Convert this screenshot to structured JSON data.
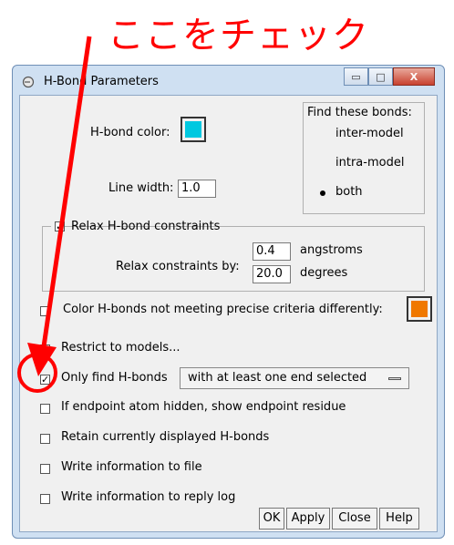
{
  "annotation": {
    "text": "ここをチェック",
    "color": "#ff0000"
  },
  "window": {
    "title": "H-Bond Parameters",
    "controls": {
      "minimize": "▭",
      "maximize": "□",
      "close": "X"
    }
  },
  "hbond_color": {
    "label": "H-bond color:",
    "color": "#00c8e0"
  },
  "line_width": {
    "label": "Line width:",
    "value": "1.0"
  },
  "find_bonds": {
    "title": "Find these bonds:",
    "options": [
      "inter-model",
      "intra-model",
      "both"
    ],
    "selected": "both"
  },
  "relax": {
    "checkbox_label": "Relax H-bond constraints",
    "checked": true,
    "by_label": "Relax constraints by:",
    "angstroms_value": "0.4",
    "angstroms_unit": "angstroms",
    "degrees_value": "20.0",
    "degrees_unit": "degrees"
  },
  "color_criteria": {
    "label": "Color H-bonds not meeting precise criteria differently:",
    "checked": false,
    "color": "#f07800"
  },
  "options": {
    "restrict_models": {
      "label": "Restrict to models...",
      "checked": false
    },
    "only_find": {
      "label": "Only find H-bonds",
      "checked": true,
      "dropdown_value": "with at least one end selected"
    },
    "endpoint_hidden": {
      "label": "If endpoint atom hidden, show endpoint residue",
      "checked": false
    },
    "retain_displayed": {
      "label": "Retain currently displayed H-bonds",
      "checked": false
    },
    "write_file": {
      "label": "Write information to file",
      "checked": false
    },
    "write_log": {
      "label": "Write information to reply log",
      "checked": false
    }
  },
  "buttons": {
    "ok": "OK",
    "apply": "Apply",
    "close": "Close",
    "help": "Help"
  },
  "check_mark": "✓"
}
